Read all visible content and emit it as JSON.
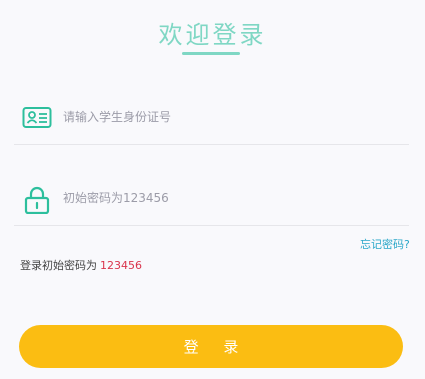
{
  "title": "欢迎登录",
  "id_field": {
    "icon": "id-card-icon",
    "placeholder": "请输入学生身份证号",
    "value": ""
  },
  "password_field": {
    "icon": "lock-icon",
    "placeholder": "初始密码为123456",
    "value": ""
  },
  "forgot_password": "忘记密码?",
  "hint": {
    "label": "登录初始密码为",
    "password": "123456"
  },
  "login_button": "登 录",
  "colors": {
    "accent_teal": "#2dbf9d",
    "title_teal": "#7fd7c4",
    "button_yellow": "#fbbd12",
    "link_blue": "#2aa7c9",
    "hint_red": "#d9344c"
  }
}
